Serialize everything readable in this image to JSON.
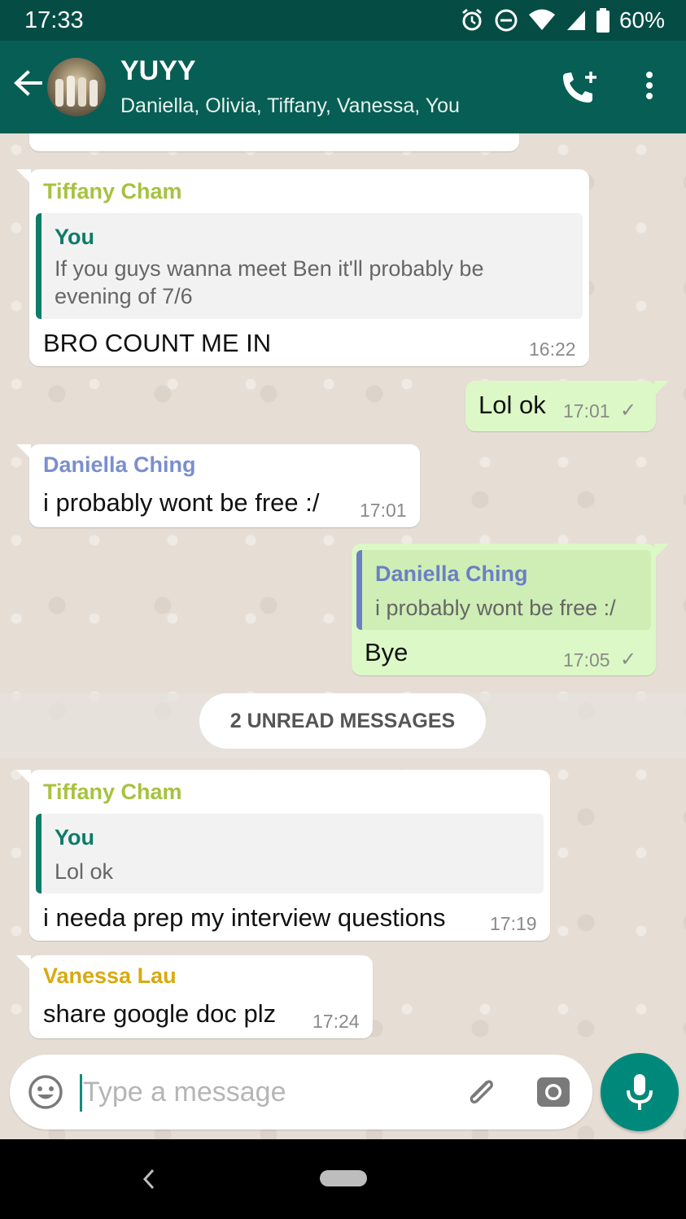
{
  "status_bar": {
    "time": "17:33",
    "battery": "60%",
    "icons": [
      "alarm-icon",
      "do-not-disturb-icon",
      "wifi-icon",
      "signal-icon",
      "battery-icon"
    ]
  },
  "header": {
    "title": "YUYY",
    "subtitle": "Daniella, Olivia, Tiffany, Vanessa, You",
    "icons": [
      "back-arrow-icon",
      "add-call-icon",
      "more-vert-icon"
    ]
  },
  "colors": {
    "header_bg": "#075e54",
    "status_bg": "#054d44",
    "outgoing_bubble": "#dcf8c6",
    "incoming_bubble": "#ffffff",
    "tiffany": "#a7c23f",
    "daniella": "#7a8fd0",
    "vanessa": "#d9a90f",
    "you": "#0d7c68",
    "accent": "#00897b"
  },
  "messages": [
    {
      "sender": "Tiffany Cham",
      "quote": {
        "name": "You",
        "text_line1": "If you guys wanna meet Ben it'll probably be",
        "text_line2": "evening of 7/6"
      },
      "text": "BRO COUNT ME IN",
      "time": "16:22"
    },
    {
      "outgoing": true,
      "text": "Lol ok",
      "time": "17:01"
    },
    {
      "sender": "Daniella Ching",
      "text": "i probably wont be free :/",
      "time": "17:01"
    },
    {
      "outgoing": true,
      "quote": {
        "name": "Daniella Ching",
        "text": "i probably wont be free :/"
      },
      "text": "Bye",
      "time": "17:05"
    },
    {
      "sender": "Tiffany Cham",
      "quote": {
        "name": "You",
        "text": "Lol ok"
      },
      "text": "i needa prep my interview questions",
      "time": "17:19"
    },
    {
      "sender": "Vanessa Lau",
      "text": "share google doc plz",
      "time": "17:24"
    }
  ],
  "unread_divider": "2 UNREAD MESSAGES",
  "composer": {
    "placeholder": "Type a message",
    "icons": [
      "emoji-icon",
      "attach-icon",
      "camera-icon",
      "mic-icon"
    ]
  },
  "nav_bar": {
    "icons": [
      "nav-back-icon",
      "nav-home-pill"
    ]
  }
}
